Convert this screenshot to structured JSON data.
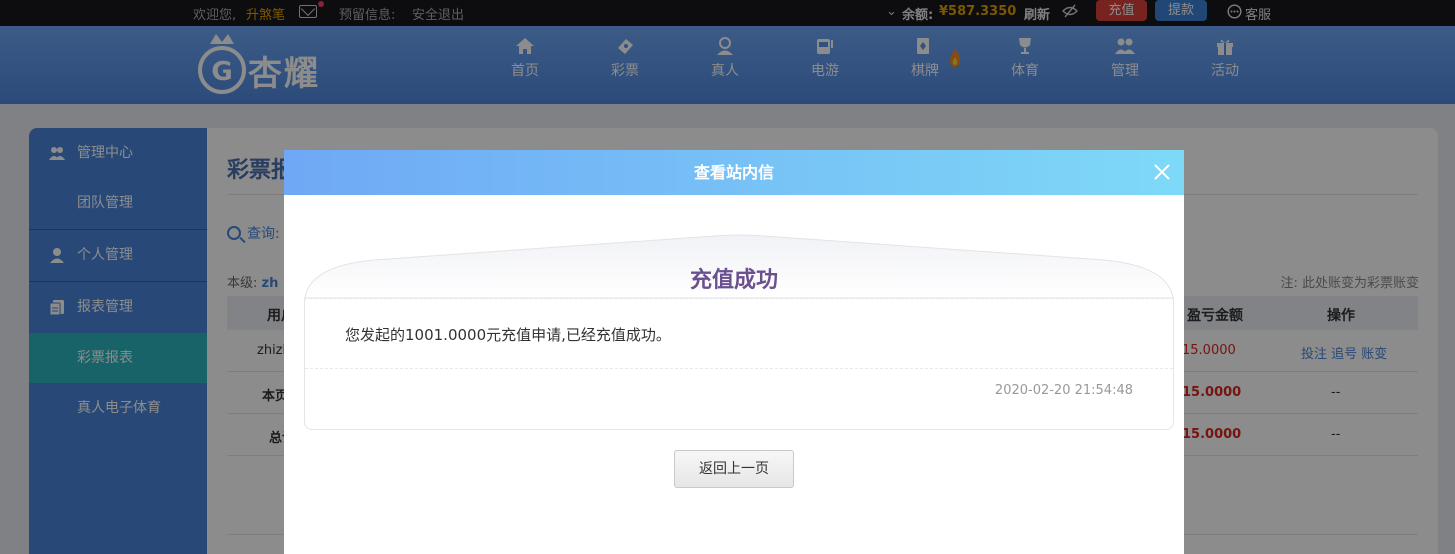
{
  "topbar": {
    "welcome": "欢迎您,",
    "username": "升煞笔",
    "reserved_info": "预留信息:",
    "logout": "安全退出",
    "balance_label": "余额:",
    "balance_value": "¥587.3350",
    "refresh": "刷新",
    "recharge": "充值",
    "withdraw": "提款",
    "service": "客服"
  },
  "header": {
    "logo_text": "杏耀",
    "nav": [
      {
        "label": "首页",
        "icon": "home-icon"
      },
      {
        "label": "彩票",
        "icon": "ticket-icon"
      },
      {
        "label": "真人",
        "icon": "person-icon"
      },
      {
        "label": "电游",
        "icon": "slot-machine-icon"
      },
      {
        "label": "棋牌",
        "icon": "cards-icon"
      },
      {
        "label": "体育",
        "icon": "trophy-icon"
      },
      {
        "label": "管理",
        "icon": "users-icon"
      },
      {
        "label": "活动",
        "icon": "gift-icon"
      }
    ]
  },
  "sidebar": {
    "items": [
      {
        "label": "管理中心",
        "type": "head",
        "icon": "users-icon"
      },
      {
        "label": "团队管理",
        "type": "sub"
      },
      {
        "label": "个人管理",
        "type": "head",
        "icon": "user-icon"
      },
      {
        "label": "报表管理",
        "type": "head",
        "icon": "report-icon"
      },
      {
        "label": "彩票报表",
        "type": "sub",
        "active": true
      },
      {
        "label": "真人电子体育",
        "type": "sub"
      }
    ]
  },
  "main": {
    "title": "彩票报",
    "query_label": "查询:",
    "level_label": "本级:",
    "level_value": "zh",
    "note": "注: 此处账变为彩票账变",
    "columns": [
      "用户",
      "盈亏金额",
      "操作"
    ],
    "rows": [
      {
        "user": "zhizh",
        "profit": "15.0000",
        "ops": "投注 追号 账变"
      },
      {
        "user": "本页",
        "profit": "15.0000",
        "ops": "--"
      },
      {
        "user": "总计",
        "profit": "15.0000",
        "ops": "--"
      }
    ]
  },
  "modal": {
    "title": "查看站内信",
    "message_title": "充值成功",
    "message_body": "您发起的1001.0000元充值申请,已经充值成功。",
    "timestamp": "2020-02-20 21:54:48",
    "back_button": "返回上一页"
  }
}
